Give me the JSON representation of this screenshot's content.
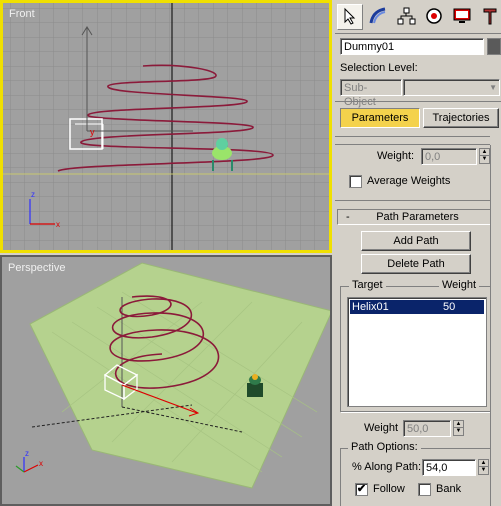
{
  "viewports": {
    "front_label": "Front",
    "perspective_label": "Perspective"
  },
  "command_panel": {
    "tabs": [
      "create-icon",
      "modify-icon",
      "hierarchy-icon",
      "motion-icon",
      "display-icon",
      "utilities-icon"
    ],
    "active_tab": "create-icon",
    "object_name": "Dummy01",
    "selection_level_label": "Selection Level:",
    "sub_object_label": "Sub-Object",
    "parameters_tab": "Parameters",
    "trajectories_tab": "Trajectories",
    "weight_label": "Weight:",
    "weight_value": "0,0",
    "average_weights_label": "Average Weights",
    "average_weights_checked": false,
    "path_parameters_title": "Path Parameters",
    "rollout_toggle": "-",
    "add_path": "Add Path",
    "delete_path": "Delete Path",
    "target_col": "Target",
    "weight_col": "Weight",
    "targets": [
      {
        "name": "Helix01",
        "weight": "50"
      }
    ],
    "target_weight_label": "Weight",
    "target_weight_value": "50,0",
    "path_options_label": "Path Options:",
    "along_path_label": "% Along Path:",
    "along_path_value": "54,0",
    "follow_label": "Follow",
    "follow_checked": "✔",
    "bank_label": "Bank",
    "bank_checked": false
  },
  "colors": {
    "viewport_bg": "#a0a0a0",
    "active_viewport_border": "#f0e000",
    "helix": "#8b1a3a",
    "ground_plane": "#b5d28e",
    "active_tab": "#f4d24c",
    "list_selection": "#0a246a"
  }
}
